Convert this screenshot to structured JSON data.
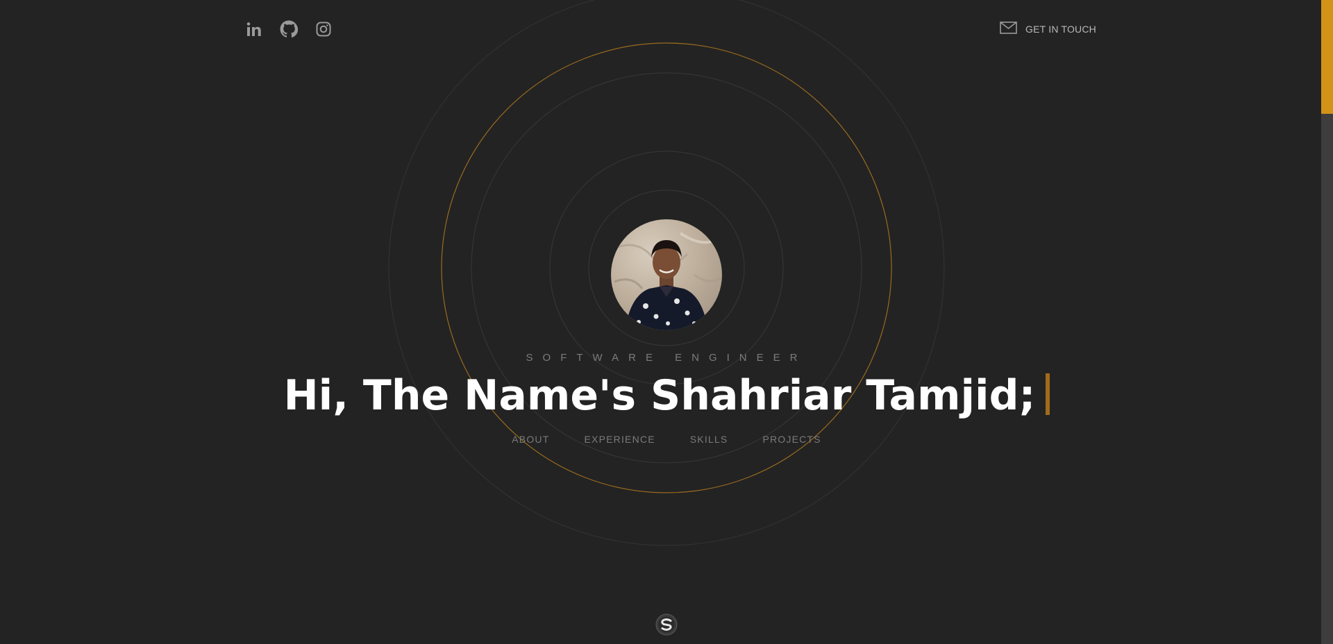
{
  "social": {
    "links": [
      {
        "name": "linkedin",
        "icon": "linkedin-icon"
      },
      {
        "name": "github",
        "icon": "github-icon"
      },
      {
        "name": "instagram",
        "icon": "instagram-icon"
      }
    ]
  },
  "contact": {
    "icon": "mail-icon",
    "label": "GET IN TOUCH"
  },
  "hero": {
    "role": "SOFTWARE ENGINEER",
    "headline": "Hi, The Name's Shahriar Tamjid;"
  },
  "nav": {
    "about": "ABOUT",
    "experience": "EXPERIENCE",
    "skills": "SKILLS",
    "projects": "PROJECTS"
  },
  "footer": {
    "logo_letter": "S"
  },
  "colors": {
    "background": "#232323",
    "accent": "#d39218",
    "ring": "#3a3a3a",
    "ring_accent": "#9a6b1e",
    "headline": "#ffffff",
    "muted": "#7b7b7b"
  }
}
